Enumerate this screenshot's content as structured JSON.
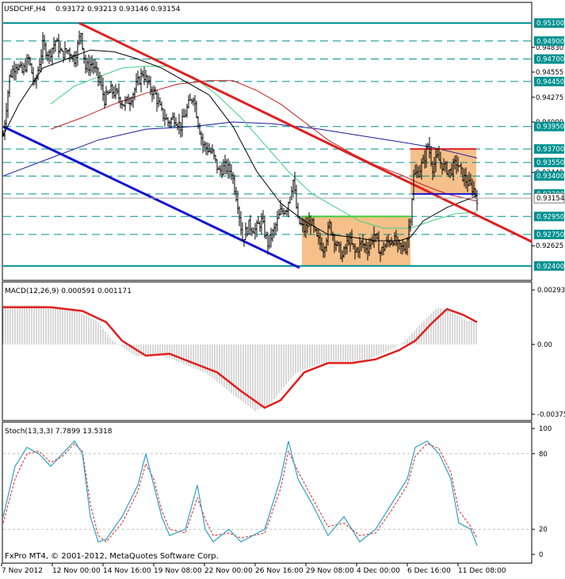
{
  "header": {
    "symbol": "USDCHF,H4",
    "ohlc": "0.93172 0.93213 0.93146 0.93154"
  },
  "macd_header": "MACD(12,26,9) 0.000591 0.001171",
  "stoch_header": "Stoch(13,3,3) 7.7899 13.5318",
  "copyright": "FxPro MT4, © 2001-2012, MetaQuotes Software Corp.",
  "colors": {
    "trend_red": "#e02020",
    "trend_blue": "#1414d0",
    "level_box": "#009090",
    "range_fill": "#f5c08a",
    "green_level": "#40d040",
    "ma_black": "#000000",
    "ma_green": "#40d080",
    "ma_darkred": "#c02020",
    "ma_navy": "#1a1aa0",
    "stoch_main": "#30a0c0",
    "stoch_signal": "#e02020",
    "macd_hist": "#b0b0b0",
    "macd_signal": "#e02020"
  },
  "chart_data": [
    {
      "type": "candlestick",
      "title": "USDCHF,H4",
      "ylim": [
        0.9231,
        0.9518
      ],
      "price_levels_boxed": [
        "0.95100",
        "0.94900",
        "0.94700",
        "0.94450",
        "0.93950",
        "0.93700",
        "0.93550",
        "0.93400",
        "0.93200",
        "0.92950",
        "0.92750",
        "0.92400"
      ],
      "price_levels_values": [
        0.951,
        0.949,
        0.947,
        0.9445,
        0.9395,
        0.937,
        0.9355,
        0.934,
        0.932,
        0.9295,
        0.9275,
        0.924
      ],
      "price_ticks": [
        "0.94830",
        "0.94555",
        "0.94275",
        "0.94000",
        "0.93440",
        "0.92625"
      ],
      "price_tick_values": [
        0.9483,
        0.94555,
        0.94275,
        0.94,
        0.9344,
        0.92625
      ],
      "current_price": "0.93154",
      "current_price_value": 0.93154,
      "close_path": [
        [
          0,
          0.9385
        ],
        [
          8,
          0.945
        ],
        [
          16,
          0.9465
        ],
        [
          24,
          0.9455
        ],
        [
          32,
          0.947
        ],
        [
          40,
          0.944
        ],
        [
          50,
          0.9485
        ],
        [
          58,
          0.9475
        ],
        [
          66,
          0.949
        ],
        [
          74,
          0.9475
        ],
        [
          82,
          0.948
        ],
        [
          90,
          0.947
        ],
        [
          98,
          0.95
        ],
        [
          104,
          0.946
        ],
        [
          112,
          0.9465
        ],
        [
          120,
          0.945
        ],
        [
          128,
          0.9425
        ],
        [
          136,
          0.9435
        ],
        [
          144,
          0.943
        ],
        [
          152,
          0.942
        ],
        [
          160,
          0.9425
        ],
        [
          168,
          0.944
        ],
        [
          176,
          0.9455
        ],
        [
          184,
          0.944
        ],
        [
          192,
          0.943
        ],
        [
          200,
          0.941
        ],
        [
          208,
          0.94
        ],
        [
          216,
          0.9405
        ],
        [
          224,
          0.9395
        ],
        [
          232,
          0.9415
        ],
        [
          240,
          0.943
        ],
        [
          246,
          0.94
        ],
        [
          252,
          0.9375
        ],
        [
          258,
          0.937
        ],
        [
          264,
          0.9365
        ],
        [
          272,
          0.9345
        ],
        [
          280,
          0.935
        ],
        [
          288,
          0.9345
        ],
        [
          296,
          0.931
        ],
        [
          302,
          0.927
        ],
        [
          310,
          0.9285
        ],
        [
          318,
          0.928
        ],
        [
          326,
          0.929
        ],
        [
          334,
          0.9265
        ],
        [
          342,
          0.928
        ],
        [
          350,
          0.93
        ],
        [
          358,
          0.9305
        ],
        [
          366,
          0.9335
        ],
        [
          372,
          0.929
        ],
        [
          380,
          0.928
        ],
        [
          388,
          0.929
        ],
        [
          396,
          0.927
        ],
        [
          404,
          0.926
        ],
        [
          412,
          0.9285
        ],
        [
          420,
          0.9265
        ],
        [
          428,
          0.925
        ],
        [
          436,
          0.927
        ],
        [
          444,
          0.9255
        ],
        [
          452,
          0.9265
        ],
        [
          460,
          0.926
        ],
        [
          468,
          0.9275
        ],
        [
          476,
          0.9255
        ],
        [
          484,
          0.9265
        ],
        [
          492,
          0.927
        ],
        [
          500,
          0.926
        ],
        [
          508,
          0.926
        ],
        [
          514,
          0.9295
        ],
        [
          518,
          0.934
        ],
        [
          524,
          0.9345
        ],
        [
          530,
          0.9355
        ],
        [
          536,
          0.9375
        ],
        [
          542,
          0.935
        ],
        [
          548,
          0.936
        ],
        [
          556,
          0.935
        ],
        [
          564,
          0.9345
        ],
        [
          572,
          0.9355
        ],
        [
          580,
          0.934
        ],
        [
          588,
          0.933
        ],
        [
          594,
          0.9325
        ],
        [
          598,
          0.93154
        ]
      ]
    },
    {
      "type": "line",
      "title": "MACD(12,26,9)",
      "ylim": [
        -0.00375,
        0.00293
      ],
      "tick_labels": [
        "0.00293",
        "0.00",
        "-0.00375"
      ],
      "tick_values": [
        0.00293,
        0.0,
        -0.00375
      ],
      "series": [
        {
          "values_path": [
            [
              0,
              0.002
            ],
            [
              60,
              0.002
            ],
            [
              100,
              0.0018
            ],
            [
              130,
              0.0012
            ],
            [
              150,
              0.0002
            ],
            [
              180,
              -0.0006
            ],
            [
              210,
              -0.0005
            ],
            [
              240,
              -0.001
            ],
            [
              270,
              -0.0015
            ],
            [
              300,
              -0.0025
            ],
            [
              330,
              -0.0034
            ],
            [
              350,
              -0.003
            ],
            [
              380,
              -0.0015
            ],
            [
              410,
              -0.001
            ],
            [
              440,
              -0.001
            ],
            [
              470,
              -0.0008
            ],
            [
              500,
              -0.0003
            ],
            [
              520,
              0.0002
            ],
            [
              540,
              0.0011
            ],
            [
              560,
              0.0019
            ],
            [
              580,
              0.0016
            ],
            [
              598,
              0.0012
            ]
          ]
        }
      ]
    },
    {
      "type": "line",
      "title": "Stoch(13,3,3)",
      "ylim": [
        0,
        100
      ],
      "tick_labels": [
        "100",
        "80",
        "20",
        "0"
      ],
      "tick_values": [
        100,
        80,
        20,
        0
      ],
      "series": [
        {
          "values_path": [
            [
              0,
              30
            ],
            [
              15,
              70
            ],
            [
              30,
              85
            ],
            [
              45,
              80
            ],
            [
              60,
              70
            ],
            [
              75,
              80
            ],
            [
              90,
              90
            ],
            [
              100,
              80
            ],
            [
              110,
              30
            ],
            [
              120,
              10
            ],
            [
              130,
              12
            ],
            [
              150,
              30
            ],
            [
              170,
              55
            ],
            [
              180,
              80
            ],
            [
              190,
              55
            ],
            [
              200,
              30
            ],
            [
              210,
              15
            ],
            [
              230,
              20
            ],
            [
              245,
              55
            ],
            [
              255,
              20
            ],
            [
              265,
              10
            ],
            [
              285,
              20
            ],
            [
              300,
              10
            ],
            [
              330,
              20
            ],
            [
              350,
              60
            ],
            [
              360,
              90
            ],
            [
              372,
              60
            ],
            [
              390,
              40
            ],
            [
              410,
              15
            ],
            [
              430,
              30
            ],
            [
              450,
              10
            ],
            [
              470,
              20
            ],
            [
              490,
              40
            ],
            [
              510,
              60
            ],
            [
              520,
              85
            ],
            [
              535,
              90
            ],
            [
              550,
              80
            ],
            [
              565,
              60
            ],
            [
              575,
              25
            ],
            [
              590,
              20
            ],
            [
              598,
              7
            ]
          ]
        },
        {
          "values_path": [
            [
              0,
              25
            ],
            [
              15,
              60
            ],
            [
              30,
              80
            ],
            [
              45,
              82
            ],
            [
              60,
              73
            ],
            [
              75,
              78
            ],
            [
              90,
              88
            ],
            [
              100,
              82
            ],
            [
              110,
              40
            ],
            [
              120,
              15
            ],
            [
              130,
              10
            ],
            [
              150,
              25
            ],
            [
              170,
              50
            ],
            [
              180,
              72
            ],
            [
              190,
              60
            ],
            [
              200,
              35
            ],
            [
              210,
              20
            ],
            [
              230,
              17
            ],
            [
              245,
              45
            ],
            [
              255,
              28
            ],
            [
              265,
              15
            ],
            [
              285,
              17
            ],
            [
              300,
              13
            ],
            [
              330,
              17
            ],
            [
              350,
              52
            ],
            [
              360,
              82
            ],
            [
              372,
              66
            ],
            [
              390,
              45
            ],
            [
              410,
              22
            ],
            [
              430,
              25
            ],
            [
              450,
              15
            ],
            [
              470,
              17
            ],
            [
              490,
              35
            ],
            [
              510,
              55
            ],
            [
              520,
              78
            ],
            [
              535,
              88
            ],
            [
              550,
              84
            ],
            [
              565,
              65
            ],
            [
              575,
              35
            ],
            [
              590,
              22
            ],
            [
              598,
              13
            ]
          ]
        }
      ]
    }
  ],
  "xaxis": {
    "ticks": [
      "7 Nov 2012",
      "12 Nov 00:00",
      "14 Nov 16:00",
      "19 Nov 08:00",
      "22 Nov 00:00",
      "26 Nov 16:00",
      "29 Nov 08:00",
      "4 Dec 00:00",
      "6 Dec 16:00",
      "11 Dec 08:00"
    ]
  }
}
